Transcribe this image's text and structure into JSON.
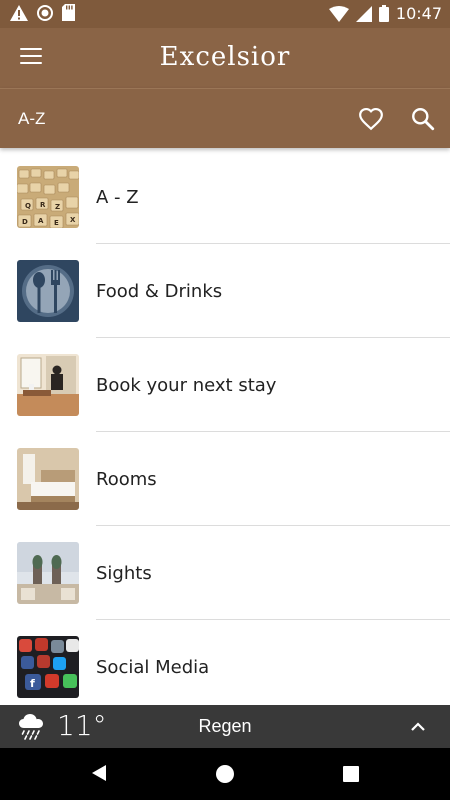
{
  "status_bar": {
    "time": "10:47",
    "left_icons": [
      "warning-icon",
      "record-icon",
      "sd-card-icon"
    ],
    "right_icons": [
      "wifi-icon",
      "signal-icon",
      "battery-icon"
    ]
  },
  "header": {
    "brand": "Excelsior",
    "subtitle": "A-Z",
    "colors": {
      "primary": "#8a6446",
      "status": "#7f5a3c"
    }
  },
  "list": {
    "items": [
      {
        "label": "A - Z",
        "icon": "letter-tiles-thumbnail"
      },
      {
        "label": "Food & Drinks",
        "icon": "spoon-fork-thumbnail"
      },
      {
        "label": "Book your next stay",
        "icon": "desk-room-thumbnail"
      },
      {
        "label": "Rooms",
        "icon": "bedroom-thumbnail"
      },
      {
        "label": "Sights",
        "icon": "cathedral-thumbnail"
      },
      {
        "label": "Social Media",
        "icon": "social-apps-thumbnail"
      }
    ]
  },
  "weather": {
    "temperature": "11°",
    "condition": "Regen",
    "icon": "rain-cloud-icon"
  }
}
